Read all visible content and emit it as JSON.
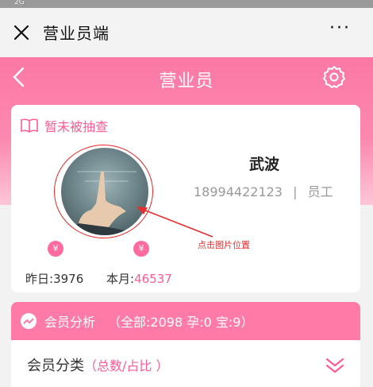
{
  "status_bar": {
    "network": "2G"
  },
  "top_bar": {
    "title": "营业员端",
    "more": "···"
  },
  "header": {
    "title": "营业员"
  },
  "profile": {
    "badge_text": "暂未被抽查",
    "name": "武波",
    "phone": "18994422123",
    "separator": "|",
    "role": "员工",
    "yen_symbol": "¥",
    "yesterday_label": "昨日:",
    "yesterday_value": "3976",
    "month_label": "本月:",
    "month_value": "46537"
  },
  "annotation": {
    "text": "点击图片位置"
  },
  "member_panel": {
    "title": "会员分析",
    "summary": "（全部:2098 孕:0 宝:9）",
    "category_label": "会员分类",
    "category_sub": "（总数/占比 ）"
  },
  "colors": {
    "accent": "#ff5b95",
    "header_pink": "#fb78a4",
    "annotation_red": "#e53030"
  }
}
